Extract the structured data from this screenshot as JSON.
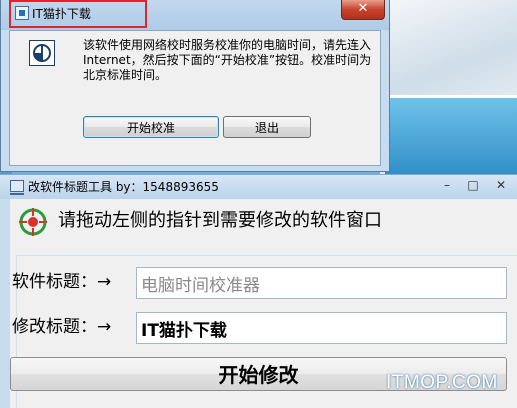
{
  "window1": {
    "title": "IT猫扑下载",
    "close_label": "✕",
    "message": "该软件使用网络校时服务校准你的电脑时间，请先连入Internet，然后按下面的“开始校准”按钮。校准时间为北京标准时间。",
    "buttons": {
      "start": "开始校准",
      "exit": "退出"
    }
  },
  "window2": {
    "title": "改软件标题工具 by：1548893655",
    "controls": {
      "minimize": "–",
      "maximize": "□",
      "close": "✕"
    },
    "instruction": "请拖动左侧的指针到需要修改的软件窗口",
    "software_title": {
      "label": "软件标题：→",
      "value": "电脑时间校准器"
    },
    "modify_title": {
      "label": "修改标题：→",
      "value": "IT猫扑下载"
    },
    "start_button": "开始修改"
  },
  "watermark": "ITMOP.COM",
  "colors": {
    "highlight_border": "#e0242b",
    "titlebar": "#bcd3ea",
    "dialog_bg": "#f0f0f0",
    "target_icon_green": "#2e9a3a",
    "target_icon_red": "#d8322b"
  }
}
